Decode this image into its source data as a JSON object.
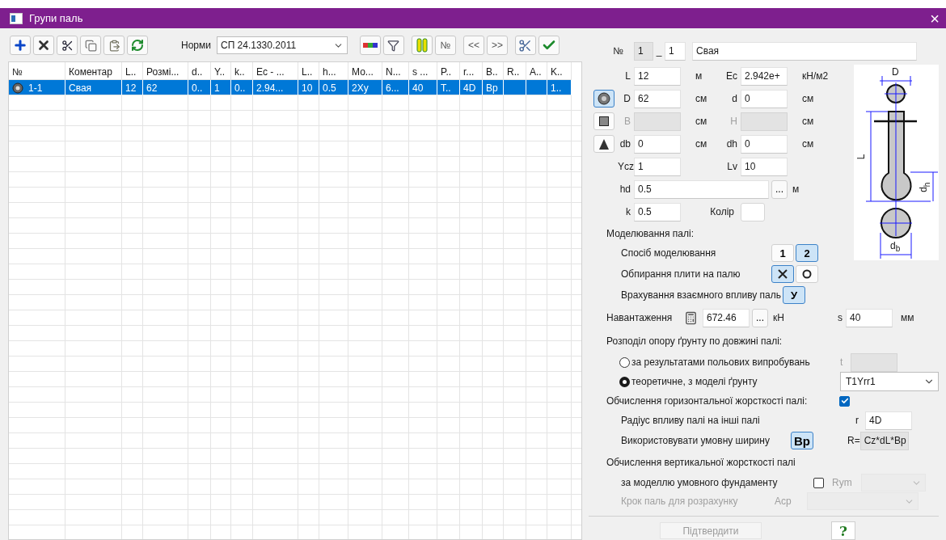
{
  "window": {
    "title": "Групи паль",
    "close": "×"
  },
  "toolbar": {
    "norms_label": "Норми",
    "norms_value": "СП 24.1330.2011",
    "number_button": "№",
    "prev_button": "<<",
    "next_button": ">>"
  },
  "table": {
    "columns": [
      "№",
      "Коментар",
      "L..",
      "Розмі...",
      "d..",
      "Y..",
      "k..",
      "Ec - ...",
      "L..",
      "h...",
      "Мо...",
      "N...",
      "s ...",
      "P..",
      "r...",
      "B..",
      "R..",
      "A..",
      "K.."
    ],
    "rows": [
      {
        "selected": true,
        "cells": [
          "1-1",
          "Свая",
          "12",
          "62",
          "0..",
          "1",
          "0..",
          "2.94...",
          "10",
          "0.5",
          "2Xy",
          "6...",
          "40",
          "T..",
          "4D",
          "Bp",
          null,
          null,
          "1.."
        ]
      }
    ]
  },
  "form": {
    "number_label": "№",
    "group": "1",
    "dash": "_",
    "index": "1",
    "comment": "Свая",
    "rows": [
      {
        "left": {
          "label": "L",
          "value": "12",
          "unit": "м"
        },
        "right": {
          "label": "Ec",
          "value": "2.942e+",
          "unit": "кН/м2"
        }
      },
      {
        "shape_button": {
          "selected": true
        },
        "left": {
          "label": "D",
          "value": "62",
          "unit": "см"
        },
        "right": {
          "label": "d",
          "value": "0",
          "unit": "см"
        }
      },
      {
        "shape_button": {
          "selected": false
        },
        "left": {
          "label": "B",
          "disabled": true,
          "unit": "см"
        },
        "right": {
          "label": "H",
          "disabled": true,
          "unit": "см"
        }
      },
      {
        "shape_button": {
          "selected": false
        },
        "left": {
          "label": "db",
          "value": "0",
          "unit": "см"
        },
        "right": {
          "label": "dh",
          "value": "0",
          "unit": "см"
        }
      },
      {
        "left": {
          "label": "Ycz",
          "value": "1"
        },
        "right": {
          "label": "Lv",
          "value": "10"
        }
      },
      {
        "left": {
          "kind": "wide",
          "label": "hd",
          "value": "0.5",
          "more": "...",
          "unit": "м"
        }
      },
      {
        "left": {
          "label": "k",
          "value": "0.5"
        },
        "right": {
          "kind": "color",
          "label": "Колір"
        }
      }
    ]
  },
  "diagram": {
    "labels": [
      "D",
      "L",
      "d$_{h}$",
      "d$_{b}$"
    ]
  },
  "modelling": {
    "title": "Моделювання палі:",
    "rows": [
      {
        "label": "Спосіб моделювання",
        "buttons": [
          {
            "kind": "text",
            "label": "1",
            "selected": false
          },
          {
            "kind": "text",
            "label": "2",
            "selected": true
          }
        ]
      },
      {
        "label": "Обпирання плити на палю",
        "buttons": [
          {
            "kind": "cross",
            "selected": true
          },
          {
            "kind": "ring",
            "selected": false
          }
        ]
      },
      {
        "label": "Врахування взаємного впливу паль",
        "buttons": [
          {
            "kind": "text",
            "label": "У",
            "selected": true
          }
        ]
      }
    ]
  },
  "load": {
    "label": "Навантаження",
    "value": "672.46",
    "more": "...",
    "unit": "кН",
    "s_label": "s",
    "s_value": "40",
    "s_unit": "мм"
  },
  "distribution": {
    "title": "Розподіл опору ґрунту по довжині палі:",
    "options": [
      {
        "label": "за результатами польових випробувань",
        "selected": false,
        "field_label": "t"
      },
      {
        "label": "теоретичне, з моделі ґрунту",
        "selected": true,
        "select": "T1Yrr1"
      }
    ]
  },
  "horizontal": {
    "title": "Обчислення горизонтальної жорсткості палі:",
    "checked": true,
    "radius_label": "Радіус впливу палі на інші палі",
    "r_label": "r",
    "r_value": "4D",
    "width_label": "Використовувати умовну ширину",
    "width_button": "Bp",
    "width_selected": true,
    "formula_label": "R=",
    "formula": "Cz*dL*Bp"
  },
  "vertical": {
    "title": "Обчислення вертикальної жорсткості палі",
    "foundation_label": "за моделлю умовного фундаменту",
    "checked": false,
    "rym_label": "Rym",
    "step_label": "Крок паль для розрахунку",
    "step_disabled": true,
    "acp_label": "Acp"
  },
  "footer": {
    "confirm": "Підтвердити",
    "confirm_disabled": true,
    "help": "?"
  }
}
